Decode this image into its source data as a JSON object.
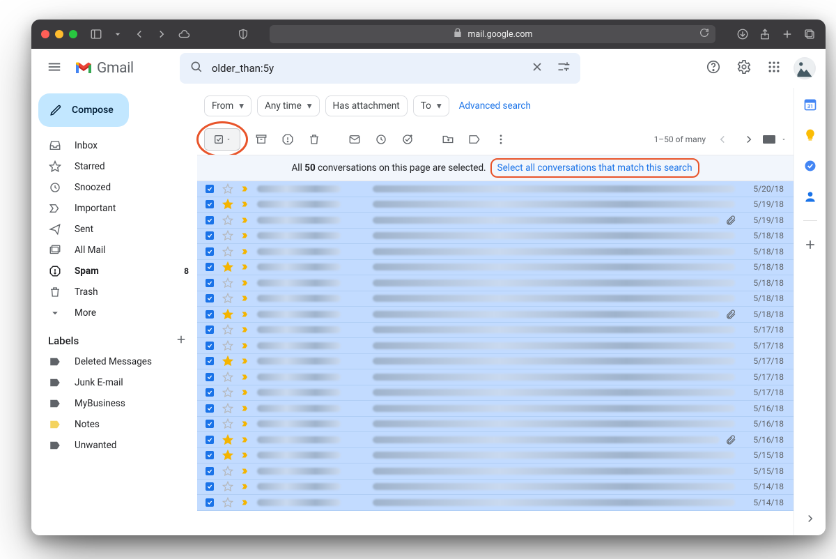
{
  "browser": {
    "url": "mail.google.com"
  },
  "header": {
    "product": "Gmail",
    "search_value": "older_than:5y"
  },
  "compose_label": "Compose",
  "sidebar": {
    "items": [
      {
        "label": "Inbox"
      },
      {
        "label": "Starred"
      },
      {
        "label": "Snoozed"
      },
      {
        "label": "Important"
      },
      {
        "label": "Sent"
      },
      {
        "label": "All Mail"
      },
      {
        "label": "Spam",
        "badge": "8",
        "bold": true
      },
      {
        "label": "Trash"
      },
      {
        "label": "More"
      }
    ],
    "labels_header": "Labels",
    "labels": [
      {
        "label": "Deleted Messages"
      },
      {
        "label": "Junk E-mail"
      },
      {
        "label": "MyBusiness"
      },
      {
        "label": "Notes",
        "color": "#f4d35e"
      },
      {
        "label": "Unwanted"
      }
    ]
  },
  "chips": {
    "from": "From",
    "anytime": "Any time",
    "has_attachment": "Has attachment",
    "to": "To",
    "advanced": "Advanced search"
  },
  "toolbar": {
    "page_info": "1–50 of many"
  },
  "banner": {
    "prefix": "All ",
    "count": "50",
    "suffix": " conversations on this page are selected.",
    "link": "Select all conversations that match this search"
  },
  "emails": [
    {
      "date": "5/20/18",
      "star": false,
      "attach": false
    },
    {
      "date": "5/19/18",
      "star": true,
      "attach": false
    },
    {
      "date": "5/19/18",
      "star": false,
      "attach": true
    },
    {
      "date": "5/18/18",
      "star": false,
      "attach": false
    },
    {
      "date": "5/18/18",
      "star": false,
      "attach": false
    },
    {
      "date": "5/18/18",
      "star": true,
      "attach": false
    },
    {
      "date": "5/18/18",
      "star": false,
      "attach": false
    },
    {
      "date": "5/18/18",
      "star": false,
      "attach": false
    },
    {
      "date": "5/18/18",
      "star": true,
      "attach": true
    },
    {
      "date": "5/17/18",
      "star": false,
      "attach": false
    },
    {
      "date": "5/17/18",
      "star": false,
      "attach": false
    },
    {
      "date": "5/17/18",
      "star": true,
      "attach": false
    },
    {
      "date": "5/17/18",
      "star": false,
      "attach": false
    },
    {
      "date": "5/17/18",
      "star": false,
      "attach": false
    },
    {
      "date": "5/16/18",
      "star": false,
      "attach": false
    },
    {
      "date": "5/16/18",
      "star": false,
      "attach": false
    },
    {
      "date": "5/16/18",
      "star": true,
      "attach": true
    },
    {
      "date": "5/15/18",
      "star": true,
      "attach": false
    },
    {
      "date": "5/15/18",
      "star": false,
      "attach": false
    },
    {
      "date": "5/14/18",
      "star": false,
      "attach": false
    },
    {
      "date": "5/14/18",
      "star": false,
      "attach": false
    }
  ]
}
